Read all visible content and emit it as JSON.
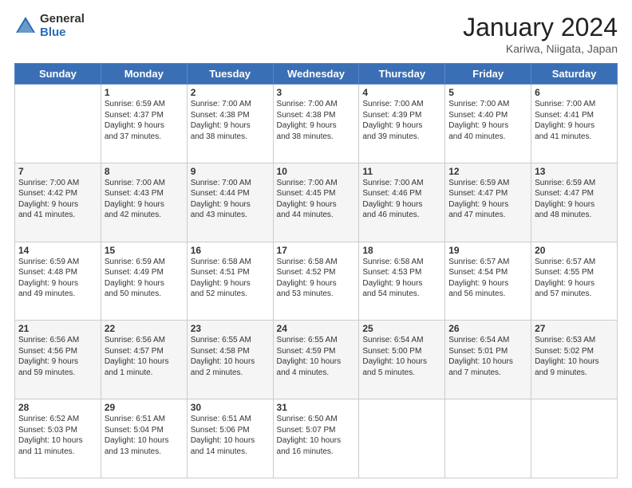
{
  "logo": {
    "general": "General",
    "blue": "Blue"
  },
  "title": "January 2024",
  "subtitle": "Kariwa, Niigata, Japan",
  "days_header": [
    "Sunday",
    "Monday",
    "Tuesday",
    "Wednesday",
    "Thursday",
    "Friday",
    "Saturday"
  ],
  "weeks": [
    [
      {
        "num": "",
        "info": ""
      },
      {
        "num": "1",
        "info": "Sunrise: 6:59 AM\nSunset: 4:37 PM\nDaylight: 9 hours\nand 37 minutes."
      },
      {
        "num": "2",
        "info": "Sunrise: 7:00 AM\nSunset: 4:38 PM\nDaylight: 9 hours\nand 38 minutes."
      },
      {
        "num": "3",
        "info": "Sunrise: 7:00 AM\nSunset: 4:38 PM\nDaylight: 9 hours\nand 38 minutes."
      },
      {
        "num": "4",
        "info": "Sunrise: 7:00 AM\nSunset: 4:39 PM\nDaylight: 9 hours\nand 39 minutes."
      },
      {
        "num": "5",
        "info": "Sunrise: 7:00 AM\nSunset: 4:40 PM\nDaylight: 9 hours\nand 40 minutes."
      },
      {
        "num": "6",
        "info": "Sunrise: 7:00 AM\nSunset: 4:41 PM\nDaylight: 9 hours\nand 41 minutes."
      }
    ],
    [
      {
        "num": "7",
        "info": "Sunrise: 7:00 AM\nSunset: 4:42 PM\nDaylight: 9 hours\nand 41 minutes."
      },
      {
        "num": "8",
        "info": "Sunrise: 7:00 AM\nSunset: 4:43 PM\nDaylight: 9 hours\nand 42 minutes."
      },
      {
        "num": "9",
        "info": "Sunrise: 7:00 AM\nSunset: 4:44 PM\nDaylight: 9 hours\nand 43 minutes."
      },
      {
        "num": "10",
        "info": "Sunrise: 7:00 AM\nSunset: 4:45 PM\nDaylight: 9 hours\nand 44 minutes."
      },
      {
        "num": "11",
        "info": "Sunrise: 7:00 AM\nSunset: 4:46 PM\nDaylight: 9 hours\nand 46 minutes."
      },
      {
        "num": "12",
        "info": "Sunrise: 6:59 AM\nSunset: 4:47 PM\nDaylight: 9 hours\nand 47 minutes."
      },
      {
        "num": "13",
        "info": "Sunrise: 6:59 AM\nSunset: 4:47 PM\nDaylight: 9 hours\nand 48 minutes."
      }
    ],
    [
      {
        "num": "14",
        "info": "Sunrise: 6:59 AM\nSunset: 4:48 PM\nDaylight: 9 hours\nand 49 minutes."
      },
      {
        "num": "15",
        "info": "Sunrise: 6:59 AM\nSunset: 4:49 PM\nDaylight: 9 hours\nand 50 minutes."
      },
      {
        "num": "16",
        "info": "Sunrise: 6:58 AM\nSunset: 4:51 PM\nDaylight: 9 hours\nand 52 minutes."
      },
      {
        "num": "17",
        "info": "Sunrise: 6:58 AM\nSunset: 4:52 PM\nDaylight: 9 hours\nand 53 minutes."
      },
      {
        "num": "18",
        "info": "Sunrise: 6:58 AM\nSunset: 4:53 PM\nDaylight: 9 hours\nand 54 minutes."
      },
      {
        "num": "19",
        "info": "Sunrise: 6:57 AM\nSunset: 4:54 PM\nDaylight: 9 hours\nand 56 minutes."
      },
      {
        "num": "20",
        "info": "Sunrise: 6:57 AM\nSunset: 4:55 PM\nDaylight: 9 hours\nand 57 minutes."
      }
    ],
    [
      {
        "num": "21",
        "info": "Sunrise: 6:56 AM\nSunset: 4:56 PM\nDaylight: 9 hours\nand 59 minutes."
      },
      {
        "num": "22",
        "info": "Sunrise: 6:56 AM\nSunset: 4:57 PM\nDaylight: 10 hours\nand 1 minute."
      },
      {
        "num": "23",
        "info": "Sunrise: 6:55 AM\nSunset: 4:58 PM\nDaylight: 10 hours\nand 2 minutes."
      },
      {
        "num": "24",
        "info": "Sunrise: 6:55 AM\nSunset: 4:59 PM\nDaylight: 10 hours\nand 4 minutes."
      },
      {
        "num": "25",
        "info": "Sunrise: 6:54 AM\nSunset: 5:00 PM\nDaylight: 10 hours\nand 5 minutes."
      },
      {
        "num": "26",
        "info": "Sunrise: 6:54 AM\nSunset: 5:01 PM\nDaylight: 10 hours\nand 7 minutes."
      },
      {
        "num": "27",
        "info": "Sunrise: 6:53 AM\nSunset: 5:02 PM\nDaylight: 10 hours\nand 9 minutes."
      }
    ],
    [
      {
        "num": "28",
        "info": "Sunrise: 6:52 AM\nSunset: 5:03 PM\nDaylight: 10 hours\nand 11 minutes."
      },
      {
        "num": "29",
        "info": "Sunrise: 6:51 AM\nSunset: 5:04 PM\nDaylight: 10 hours\nand 13 minutes."
      },
      {
        "num": "30",
        "info": "Sunrise: 6:51 AM\nSunset: 5:06 PM\nDaylight: 10 hours\nand 14 minutes."
      },
      {
        "num": "31",
        "info": "Sunrise: 6:50 AM\nSunset: 5:07 PM\nDaylight: 10 hours\nand 16 minutes."
      },
      {
        "num": "",
        "info": ""
      },
      {
        "num": "",
        "info": ""
      },
      {
        "num": "",
        "info": ""
      }
    ]
  ]
}
